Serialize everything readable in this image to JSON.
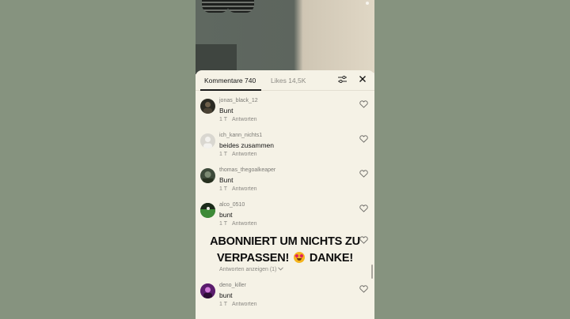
{
  "tabs": {
    "comments": "Kommentare 740",
    "likes": "Likes 14,5K"
  },
  "icons": {
    "filter": "filter-icon",
    "close": "close-icon",
    "like": "heart-outline-icon"
  },
  "comments": [
    {
      "user": "jonas_black_12",
      "text": "Bunt",
      "time": "1 T",
      "reply": "Antworten",
      "avatar_color": "#2a2a22"
    },
    {
      "user": "ich_kann_nichts1",
      "text": "beides zusammen",
      "time": "1 T",
      "reply": "Antworten",
      "avatar_color": "#d9d7d0"
    },
    {
      "user": "thomas_thegoalkeaper",
      "text": "Bunt",
      "time": "1 T",
      "reply": "Antworten",
      "avatar_color": "#3d4a3a"
    },
    {
      "user": "alco_0510",
      "text": "bunt",
      "time": "1 T",
      "reply": "Antworten",
      "avatar_color": "#2f6a2c"
    },
    {
      "user": "deno_killer",
      "text": "bunt",
      "time": "1 T",
      "reply": "Antworten",
      "avatar_color": "#7a2a8c"
    }
  ],
  "view_replies": "Antworten anzeigen (1)",
  "overlay": {
    "line1": "ABONNIERT UM NICHTS ZU",
    "line2_a": "VERPASSEN!",
    "line2_b": "DANKE!"
  },
  "colors": {
    "sheet_bg": "#f5f2e6",
    "page_bg": "#86937f"
  }
}
